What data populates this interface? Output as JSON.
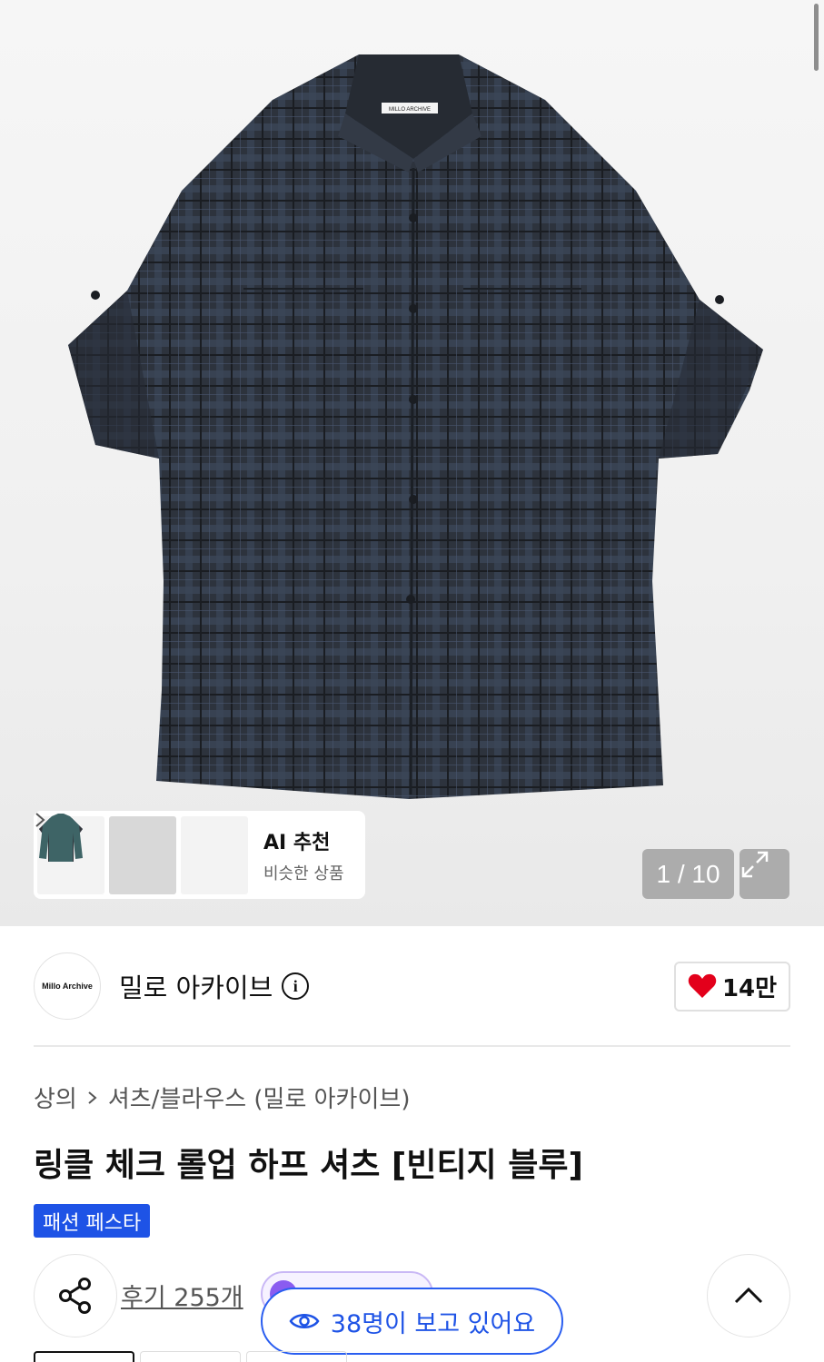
{
  "gallery": {
    "counter": "1 / 10",
    "thumbnails": [
      "navy-shirt-thumbnail",
      "charcoal-check-shirt-thumbnail",
      "green-shirt-thumbnail"
    ],
    "ai_title": "AI 추천",
    "ai_subtitle": "비슷한 상품"
  },
  "brand": {
    "logo_text": "Millo Archive",
    "name": "밀로 아카이브",
    "likes": "14만"
  },
  "product": {
    "breadcrumb": [
      "상의",
      "셔츠/블라우스 (밀로 아카이브)"
    ],
    "title": "링클 체크 롤업 하프 셔츠 [빈티지 블루]",
    "badge": "패션 페스타"
  },
  "actions": {
    "reviews": "후기 255개",
    "viewers": "38명이 보고 있어요"
  },
  "colors": {
    "accent": "#1e53e6",
    "heart": "#e3001b",
    "chip": "#8a5cf0"
  },
  "icons": [
    "share-icon",
    "info-icon",
    "heart-icon",
    "expand-icon",
    "chevron-right-icon",
    "chevron-up-icon",
    "eye-icon"
  ]
}
